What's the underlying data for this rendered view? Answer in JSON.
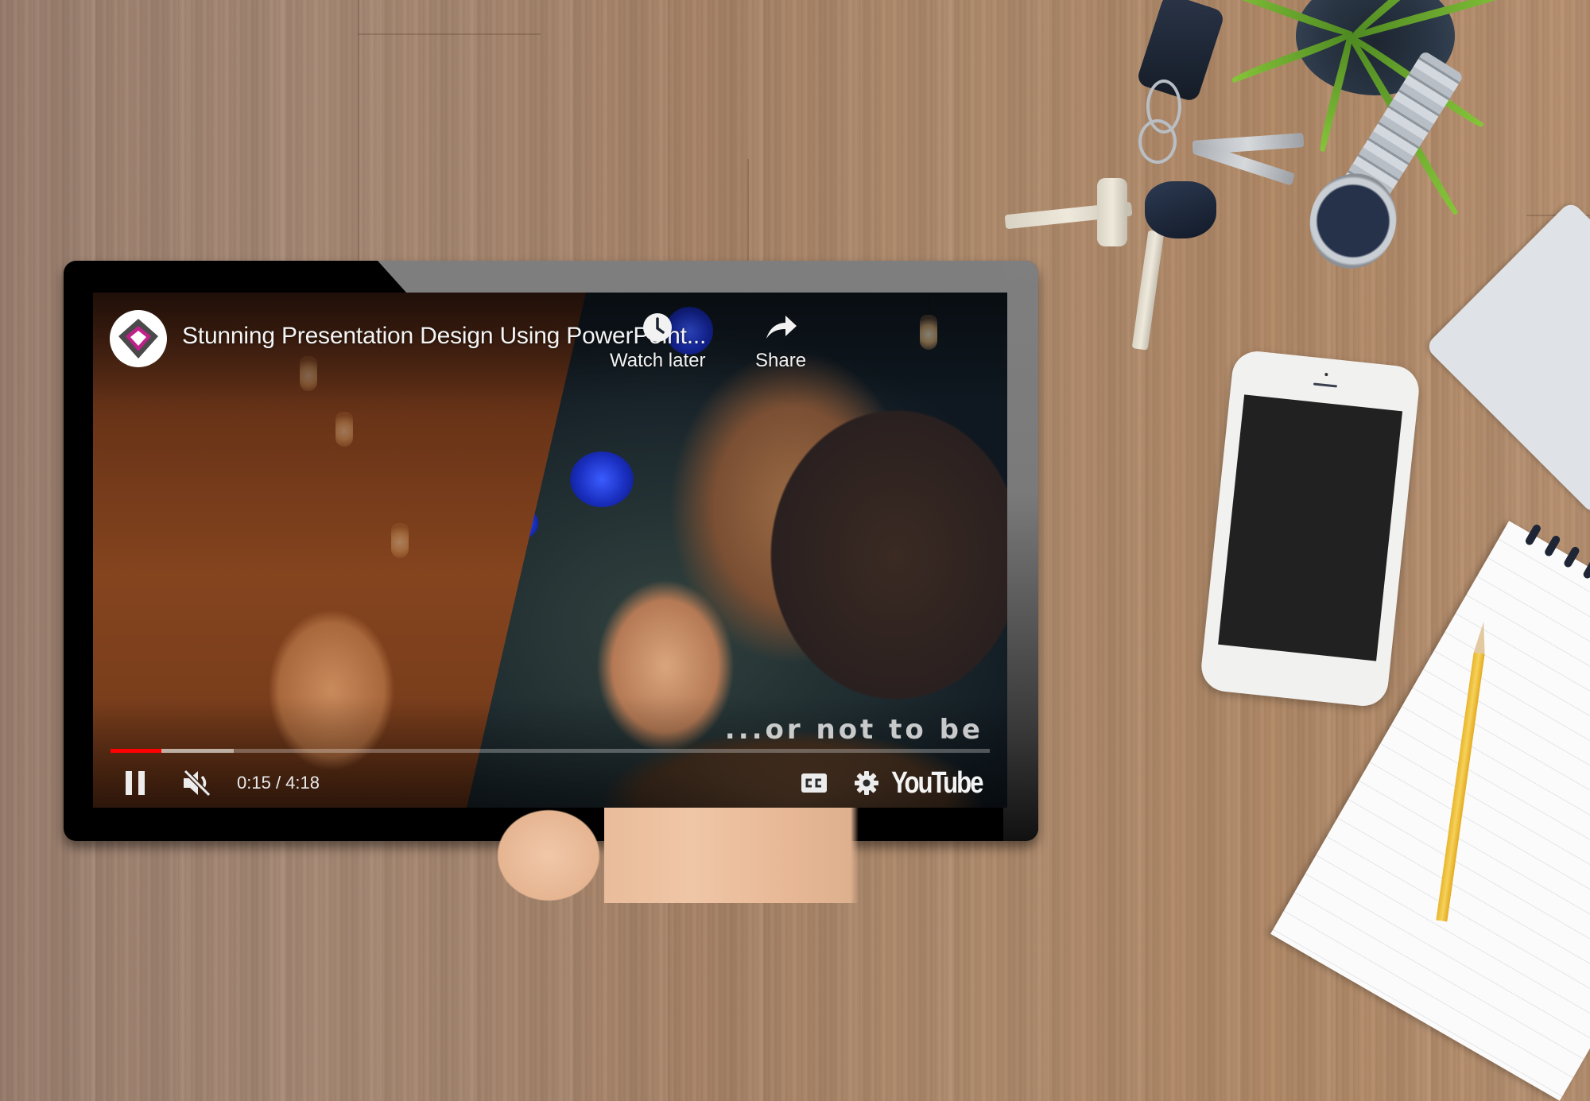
{
  "scene": {
    "description": "Tablet on wooden desk playing an embedded YouTube video",
    "desk_objects": [
      "plant",
      "keys",
      "wristwatch",
      "smartphone",
      "laptop-corner",
      "spiral-notebook",
      "pencil",
      "hand"
    ]
  },
  "player": {
    "channel_avatar_icon": "diamond-logo-icon",
    "title": "Stunning Presentation Design Using PowerPoint...",
    "top_actions": [
      {
        "label": "Watch later",
        "icon": "clock-icon"
      },
      {
        "label": "Share",
        "icon": "share-arrow-icon"
      }
    ],
    "subtitle_text": "...or not to be",
    "controls": {
      "play_state_icon": "pause-icon",
      "volume_icon": "muted-speaker-icon",
      "current_time": "0:15",
      "duration": "4:18",
      "time_display": "0:15 / 4:18",
      "captions_icon": "cc-icon",
      "settings_icon": "gear-icon",
      "brand_label": "YouTube"
    },
    "progress": {
      "played_fraction": 0.058,
      "buffered_fraction": 0.14
    }
  },
  "colors": {
    "progress_played": "#ff0000",
    "avatar_magenta": "#c0208a",
    "avatar_grey": "#4a4a4a",
    "text": "#f4f4f4"
  }
}
